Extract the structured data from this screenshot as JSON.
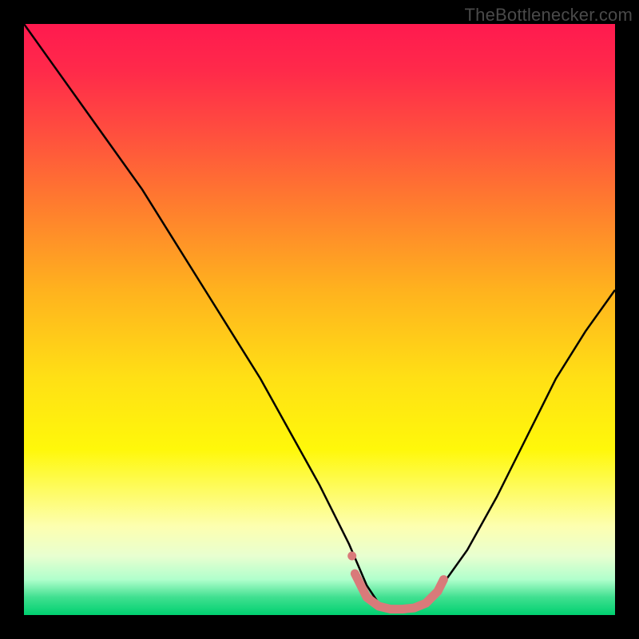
{
  "watermark": "TheBottlenecker.com",
  "chart_data": {
    "type": "line",
    "title": "",
    "xlabel": "",
    "ylabel": "",
    "xlim": [
      0,
      100
    ],
    "ylim": [
      0,
      100
    ],
    "background_gradient": {
      "top": "#ff1a4f",
      "middle": "#ffe015",
      "bottom": "#00d070"
    },
    "series": [
      {
        "name": "curve",
        "color": "#000000",
        "x": [
          0,
          5,
          10,
          15,
          20,
          25,
          30,
          35,
          40,
          45,
          50,
          55,
          58,
          60,
          62,
          64,
          66,
          68,
          70,
          75,
          80,
          85,
          90,
          95,
          100
        ],
        "y": [
          100,
          93,
          86,
          79,
          72,
          64,
          56,
          48,
          40,
          31,
          22,
          12,
          5,
          2,
          1,
          1,
          1,
          2,
          4,
          11,
          20,
          30,
          40,
          48,
          55
        ]
      }
    ],
    "marker_region": {
      "name": "valley-markers",
      "color": "#d97a7a",
      "points": [
        {
          "x": 56,
          "y": 7
        },
        {
          "x": 58,
          "y": 3
        },
        {
          "x": 60,
          "y": 1.5
        },
        {
          "x": 62,
          "y": 1
        },
        {
          "x": 64,
          "y": 1
        },
        {
          "x": 66,
          "y": 1.2
        },
        {
          "x": 68,
          "y": 2
        },
        {
          "x": 70,
          "y": 4
        },
        {
          "x": 71,
          "y": 6
        }
      ]
    }
  }
}
